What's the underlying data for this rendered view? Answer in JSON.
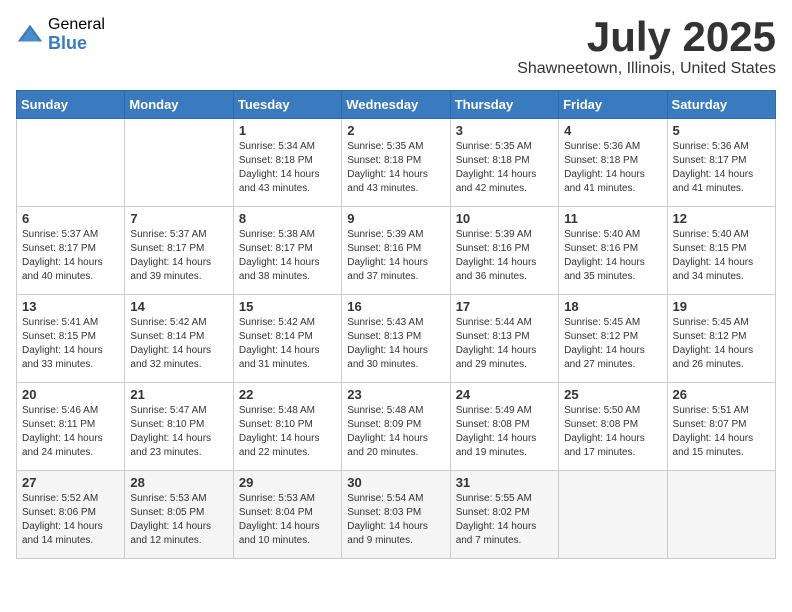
{
  "logo": {
    "general": "General",
    "blue": "Blue"
  },
  "title": {
    "month": "July 2025",
    "location": "Shawneetown, Illinois, United States"
  },
  "weekdays": [
    "Sunday",
    "Monday",
    "Tuesday",
    "Wednesday",
    "Thursday",
    "Friday",
    "Saturday"
  ],
  "weeks": [
    [
      {
        "day": "",
        "sunrise": "",
        "sunset": "",
        "daylight": ""
      },
      {
        "day": "",
        "sunrise": "",
        "sunset": "",
        "daylight": ""
      },
      {
        "day": "1",
        "sunrise": "Sunrise: 5:34 AM",
        "sunset": "Sunset: 8:18 PM",
        "daylight": "Daylight: 14 hours and 43 minutes."
      },
      {
        "day": "2",
        "sunrise": "Sunrise: 5:35 AM",
        "sunset": "Sunset: 8:18 PM",
        "daylight": "Daylight: 14 hours and 43 minutes."
      },
      {
        "day": "3",
        "sunrise": "Sunrise: 5:35 AM",
        "sunset": "Sunset: 8:18 PM",
        "daylight": "Daylight: 14 hours and 42 minutes."
      },
      {
        "day": "4",
        "sunrise": "Sunrise: 5:36 AM",
        "sunset": "Sunset: 8:18 PM",
        "daylight": "Daylight: 14 hours and 41 minutes."
      },
      {
        "day": "5",
        "sunrise": "Sunrise: 5:36 AM",
        "sunset": "Sunset: 8:17 PM",
        "daylight": "Daylight: 14 hours and 41 minutes."
      }
    ],
    [
      {
        "day": "6",
        "sunrise": "Sunrise: 5:37 AM",
        "sunset": "Sunset: 8:17 PM",
        "daylight": "Daylight: 14 hours and 40 minutes."
      },
      {
        "day": "7",
        "sunrise": "Sunrise: 5:37 AM",
        "sunset": "Sunset: 8:17 PM",
        "daylight": "Daylight: 14 hours and 39 minutes."
      },
      {
        "day": "8",
        "sunrise": "Sunrise: 5:38 AM",
        "sunset": "Sunset: 8:17 PM",
        "daylight": "Daylight: 14 hours and 38 minutes."
      },
      {
        "day": "9",
        "sunrise": "Sunrise: 5:39 AM",
        "sunset": "Sunset: 8:16 PM",
        "daylight": "Daylight: 14 hours and 37 minutes."
      },
      {
        "day": "10",
        "sunrise": "Sunrise: 5:39 AM",
        "sunset": "Sunset: 8:16 PM",
        "daylight": "Daylight: 14 hours and 36 minutes."
      },
      {
        "day": "11",
        "sunrise": "Sunrise: 5:40 AM",
        "sunset": "Sunset: 8:16 PM",
        "daylight": "Daylight: 14 hours and 35 minutes."
      },
      {
        "day": "12",
        "sunrise": "Sunrise: 5:40 AM",
        "sunset": "Sunset: 8:15 PM",
        "daylight": "Daylight: 14 hours and 34 minutes."
      }
    ],
    [
      {
        "day": "13",
        "sunrise": "Sunrise: 5:41 AM",
        "sunset": "Sunset: 8:15 PM",
        "daylight": "Daylight: 14 hours and 33 minutes."
      },
      {
        "day": "14",
        "sunrise": "Sunrise: 5:42 AM",
        "sunset": "Sunset: 8:14 PM",
        "daylight": "Daylight: 14 hours and 32 minutes."
      },
      {
        "day": "15",
        "sunrise": "Sunrise: 5:42 AM",
        "sunset": "Sunset: 8:14 PM",
        "daylight": "Daylight: 14 hours and 31 minutes."
      },
      {
        "day": "16",
        "sunrise": "Sunrise: 5:43 AM",
        "sunset": "Sunset: 8:13 PM",
        "daylight": "Daylight: 14 hours and 30 minutes."
      },
      {
        "day": "17",
        "sunrise": "Sunrise: 5:44 AM",
        "sunset": "Sunset: 8:13 PM",
        "daylight": "Daylight: 14 hours and 29 minutes."
      },
      {
        "day": "18",
        "sunrise": "Sunrise: 5:45 AM",
        "sunset": "Sunset: 8:12 PM",
        "daylight": "Daylight: 14 hours and 27 minutes."
      },
      {
        "day": "19",
        "sunrise": "Sunrise: 5:45 AM",
        "sunset": "Sunset: 8:12 PM",
        "daylight": "Daylight: 14 hours and 26 minutes."
      }
    ],
    [
      {
        "day": "20",
        "sunrise": "Sunrise: 5:46 AM",
        "sunset": "Sunset: 8:11 PM",
        "daylight": "Daylight: 14 hours and 24 minutes."
      },
      {
        "day": "21",
        "sunrise": "Sunrise: 5:47 AM",
        "sunset": "Sunset: 8:10 PM",
        "daylight": "Daylight: 14 hours and 23 minutes."
      },
      {
        "day": "22",
        "sunrise": "Sunrise: 5:48 AM",
        "sunset": "Sunset: 8:10 PM",
        "daylight": "Daylight: 14 hours and 22 minutes."
      },
      {
        "day": "23",
        "sunrise": "Sunrise: 5:48 AM",
        "sunset": "Sunset: 8:09 PM",
        "daylight": "Daylight: 14 hours and 20 minutes."
      },
      {
        "day": "24",
        "sunrise": "Sunrise: 5:49 AM",
        "sunset": "Sunset: 8:08 PM",
        "daylight": "Daylight: 14 hours and 19 minutes."
      },
      {
        "day": "25",
        "sunrise": "Sunrise: 5:50 AM",
        "sunset": "Sunset: 8:08 PM",
        "daylight": "Daylight: 14 hours and 17 minutes."
      },
      {
        "day": "26",
        "sunrise": "Sunrise: 5:51 AM",
        "sunset": "Sunset: 8:07 PM",
        "daylight": "Daylight: 14 hours and 15 minutes."
      }
    ],
    [
      {
        "day": "27",
        "sunrise": "Sunrise: 5:52 AM",
        "sunset": "Sunset: 8:06 PM",
        "daylight": "Daylight: 14 hours and 14 minutes."
      },
      {
        "day": "28",
        "sunrise": "Sunrise: 5:53 AM",
        "sunset": "Sunset: 8:05 PM",
        "daylight": "Daylight: 14 hours and 12 minutes."
      },
      {
        "day": "29",
        "sunrise": "Sunrise: 5:53 AM",
        "sunset": "Sunset: 8:04 PM",
        "daylight": "Daylight: 14 hours and 10 minutes."
      },
      {
        "day": "30",
        "sunrise": "Sunrise: 5:54 AM",
        "sunset": "Sunset: 8:03 PM",
        "daylight": "Daylight: 14 hours and 9 minutes."
      },
      {
        "day": "31",
        "sunrise": "Sunrise: 5:55 AM",
        "sunset": "Sunset: 8:02 PM",
        "daylight": "Daylight: 14 hours and 7 minutes."
      },
      {
        "day": "",
        "sunrise": "",
        "sunset": "",
        "daylight": ""
      },
      {
        "day": "",
        "sunrise": "",
        "sunset": "",
        "daylight": ""
      }
    ]
  ]
}
